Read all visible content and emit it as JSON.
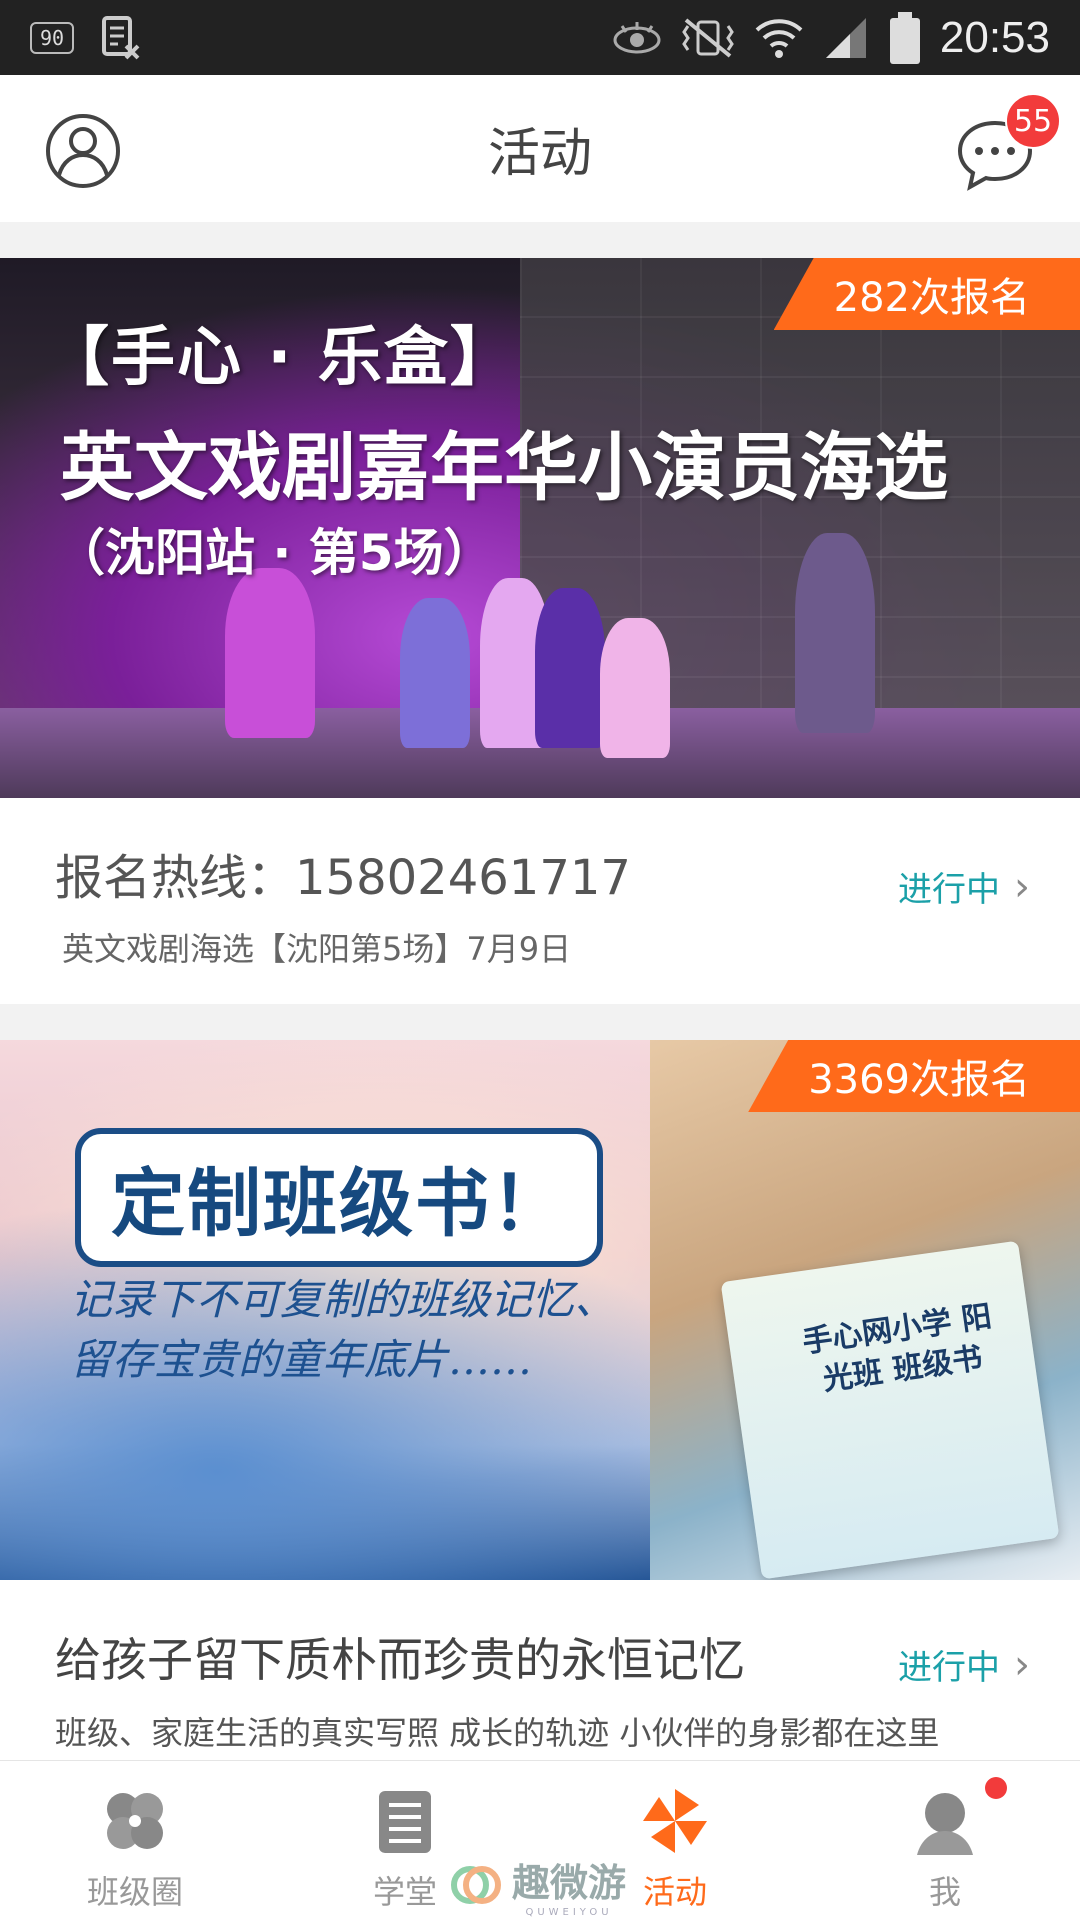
{
  "status_bar": {
    "left_badge": "90",
    "time": "20:53",
    "icons": [
      "sim-icon",
      "eye-icon",
      "vibrate-off-icon",
      "wifi-icon",
      "signal-icon",
      "battery-icon"
    ]
  },
  "header": {
    "title": "活动",
    "message_count": "55"
  },
  "activities": [
    {
      "registrations": "282次报名",
      "banner_line1": "【手心 · 乐盒】",
      "banner_line2": "英文戏剧嘉年华小演员海选",
      "banner_line3": "（沈阳站 · 第5场）",
      "title": "报名热线：15802461717",
      "subtitle": "英文戏剧海选【沈阳第5场】7月9日",
      "status": "进行中"
    },
    {
      "registrations": "3369次报名",
      "banner_title": "定制班级书！",
      "banner_sub1": "记录下不可复制的班级记忆、",
      "banner_sub2": "留存宝贵的童年底片……",
      "book_text": "手心网小学 阳光班 班级书",
      "title": "给孩子留下质朴而珍贵的永恒记忆",
      "subtitle": "班级、家庭生活的真实写照 成长的轨迹 小伙伴的身影都在这里",
      "status": "进行中"
    }
  ],
  "tabs": [
    {
      "label": "班级圈",
      "icon": "class-circle-icon",
      "active": false
    },
    {
      "label": "学堂",
      "icon": "school-book-icon",
      "active": false
    },
    {
      "label": "活动",
      "icon": "pinwheel-icon",
      "active": true
    },
    {
      "label": "我",
      "icon": "user-icon",
      "active": false
    }
  ],
  "watermark": {
    "text": "趣微游",
    "small": "QUWEIYOU"
  },
  "colors": {
    "accent": "#ff6a1a",
    "status_teal": "#1ba0a8",
    "badge_red": "#f23b3b"
  }
}
